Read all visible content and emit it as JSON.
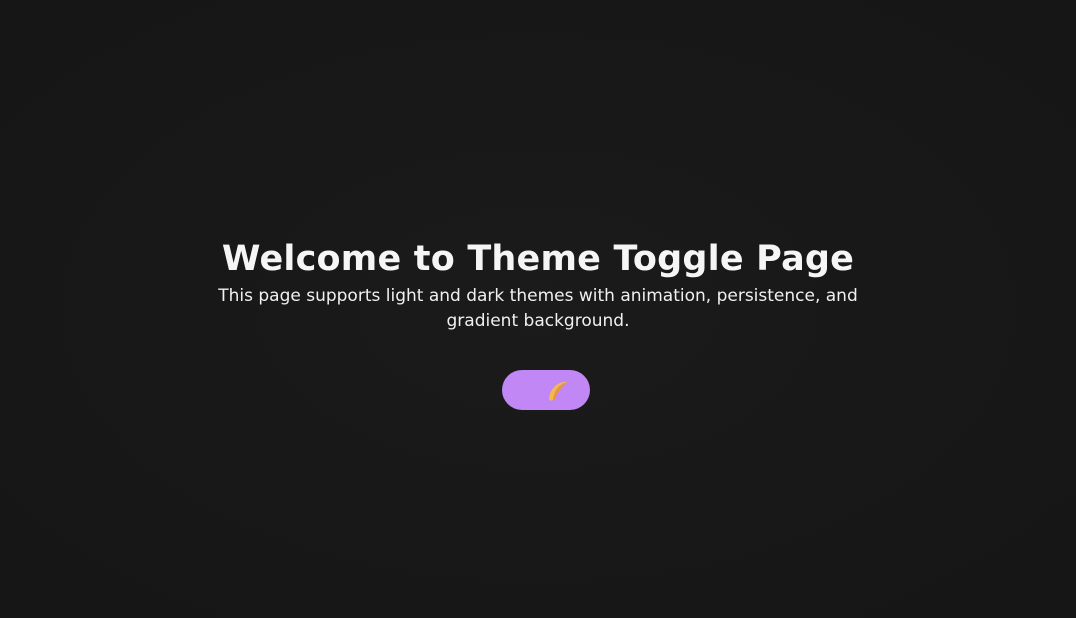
{
  "page": {
    "title": "Welcome to Theme Toggle Page",
    "subtitle": "This page supports light and dark themes with animation, persistence, and gradient background."
  },
  "theme_toggle": {
    "state": "dark",
    "icon": "crescent-moon-icon",
    "track_color": "#c087f5",
    "icon_color": "#f5b94a"
  },
  "colors": {
    "background": "#171717",
    "text": "#f2f2f2"
  }
}
